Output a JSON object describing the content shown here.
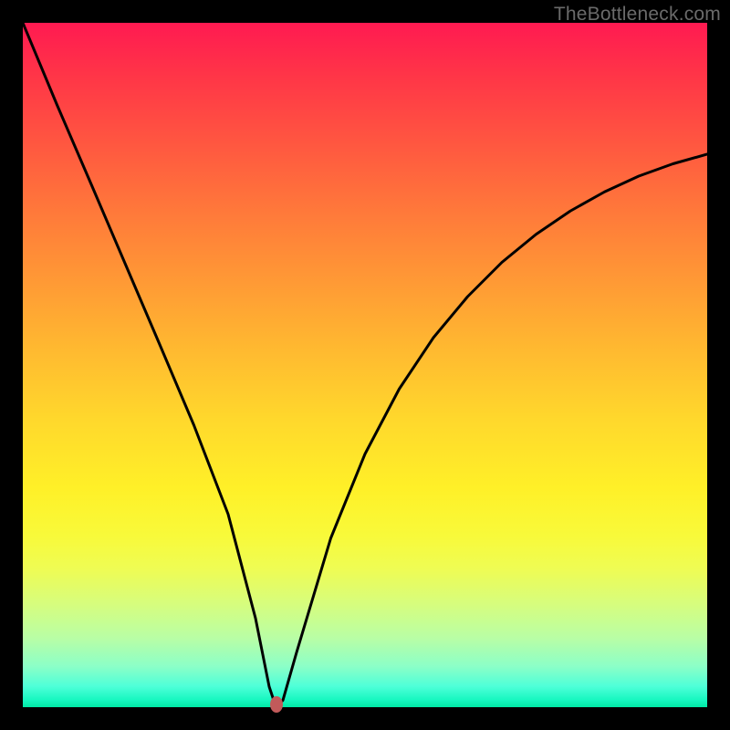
{
  "watermark": "TheBottleneck.com",
  "chart_data": {
    "type": "line",
    "title": "",
    "xlabel": "",
    "ylabel": "",
    "xlim": [
      0,
      100
    ],
    "ylim": [
      0,
      100
    ],
    "background_gradient": {
      "top_color": "#ff1a51",
      "mid_color": "#ffd82c",
      "bottom_color": "#00e8a5"
    },
    "series": [
      {
        "name": "bottleneck-curve",
        "x": [
          0,
          5,
          10,
          15,
          20,
          25,
          30,
          34,
          36,
          37,
          38,
          40,
          45,
          50,
          55,
          60,
          65,
          70,
          75,
          80,
          85,
          90,
          95,
          100
        ],
        "values": [
          100,
          88,
          76.4,
          64.7,
          53.0,
          41.2,
          28.2,
          13.0,
          3.0,
          0.0,
          1.0,
          8.0,
          24.7,
          37.0,
          46.5,
          54.0,
          60.0,
          65.0,
          69.1,
          72.5,
          75.3,
          77.6,
          79.4,
          80.8
        ]
      }
    ],
    "marker": {
      "x": 37,
      "y": 0,
      "color": "#c25a5a"
    }
  }
}
